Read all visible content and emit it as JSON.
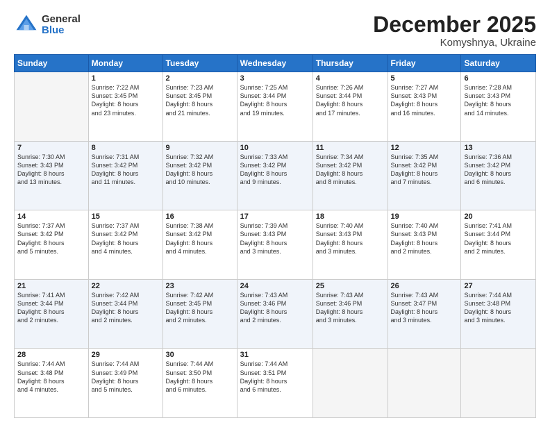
{
  "header": {
    "logo_general": "General",
    "logo_blue": "Blue",
    "month_title": "December 2025",
    "subtitle": "Komyshnya, Ukraine"
  },
  "days_of_week": [
    "Sunday",
    "Monday",
    "Tuesday",
    "Wednesday",
    "Thursday",
    "Friday",
    "Saturday"
  ],
  "weeks": [
    [
      {
        "day": "",
        "info": ""
      },
      {
        "day": "1",
        "info": "Sunrise: 7:22 AM\nSunset: 3:45 PM\nDaylight: 8 hours\nand 23 minutes."
      },
      {
        "day": "2",
        "info": "Sunrise: 7:23 AM\nSunset: 3:45 PM\nDaylight: 8 hours\nand 21 minutes."
      },
      {
        "day": "3",
        "info": "Sunrise: 7:25 AM\nSunset: 3:44 PM\nDaylight: 8 hours\nand 19 minutes."
      },
      {
        "day": "4",
        "info": "Sunrise: 7:26 AM\nSunset: 3:44 PM\nDaylight: 8 hours\nand 17 minutes."
      },
      {
        "day": "5",
        "info": "Sunrise: 7:27 AM\nSunset: 3:43 PM\nDaylight: 8 hours\nand 16 minutes."
      },
      {
        "day": "6",
        "info": "Sunrise: 7:28 AM\nSunset: 3:43 PM\nDaylight: 8 hours\nand 14 minutes."
      }
    ],
    [
      {
        "day": "7",
        "info": "Sunrise: 7:30 AM\nSunset: 3:43 PM\nDaylight: 8 hours\nand 13 minutes."
      },
      {
        "day": "8",
        "info": "Sunrise: 7:31 AM\nSunset: 3:42 PM\nDaylight: 8 hours\nand 11 minutes."
      },
      {
        "day": "9",
        "info": "Sunrise: 7:32 AM\nSunset: 3:42 PM\nDaylight: 8 hours\nand 10 minutes."
      },
      {
        "day": "10",
        "info": "Sunrise: 7:33 AM\nSunset: 3:42 PM\nDaylight: 8 hours\nand 9 minutes."
      },
      {
        "day": "11",
        "info": "Sunrise: 7:34 AM\nSunset: 3:42 PM\nDaylight: 8 hours\nand 8 minutes."
      },
      {
        "day": "12",
        "info": "Sunrise: 7:35 AM\nSunset: 3:42 PM\nDaylight: 8 hours\nand 7 minutes."
      },
      {
        "day": "13",
        "info": "Sunrise: 7:36 AM\nSunset: 3:42 PM\nDaylight: 8 hours\nand 6 minutes."
      }
    ],
    [
      {
        "day": "14",
        "info": "Sunrise: 7:37 AM\nSunset: 3:42 PM\nDaylight: 8 hours\nand 5 minutes."
      },
      {
        "day": "15",
        "info": "Sunrise: 7:37 AM\nSunset: 3:42 PM\nDaylight: 8 hours\nand 4 minutes."
      },
      {
        "day": "16",
        "info": "Sunrise: 7:38 AM\nSunset: 3:42 PM\nDaylight: 8 hours\nand 4 minutes."
      },
      {
        "day": "17",
        "info": "Sunrise: 7:39 AM\nSunset: 3:43 PM\nDaylight: 8 hours\nand 3 minutes."
      },
      {
        "day": "18",
        "info": "Sunrise: 7:40 AM\nSunset: 3:43 PM\nDaylight: 8 hours\nand 3 minutes."
      },
      {
        "day": "19",
        "info": "Sunrise: 7:40 AM\nSunset: 3:43 PM\nDaylight: 8 hours\nand 2 minutes."
      },
      {
        "day": "20",
        "info": "Sunrise: 7:41 AM\nSunset: 3:44 PM\nDaylight: 8 hours\nand 2 minutes."
      }
    ],
    [
      {
        "day": "21",
        "info": "Sunrise: 7:41 AM\nSunset: 3:44 PM\nDaylight: 8 hours\nand 2 minutes."
      },
      {
        "day": "22",
        "info": "Sunrise: 7:42 AM\nSunset: 3:44 PM\nDaylight: 8 hours\nand 2 minutes."
      },
      {
        "day": "23",
        "info": "Sunrise: 7:42 AM\nSunset: 3:45 PM\nDaylight: 8 hours\nand 2 minutes."
      },
      {
        "day": "24",
        "info": "Sunrise: 7:43 AM\nSunset: 3:46 PM\nDaylight: 8 hours\nand 2 minutes."
      },
      {
        "day": "25",
        "info": "Sunrise: 7:43 AM\nSunset: 3:46 PM\nDaylight: 8 hours\nand 3 minutes."
      },
      {
        "day": "26",
        "info": "Sunrise: 7:43 AM\nSunset: 3:47 PM\nDaylight: 8 hours\nand 3 minutes."
      },
      {
        "day": "27",
        "info": "Sunrise: 7:44 AM\nSunset: 3:48 PM\nDaylight: 8 hours\nand 3 minutes."
      }
    ],
    [
      {
        "day": "28",
        "info": "Sunrise: 7:44 AM\nSunset: 3:48 PM\nDaylight: 8 hours\nand 4 minutes."
      },
      {
        "day": "29",
        "info": "Sunrise: 7:44 AM\nSunset: 3:49 PM\nDaylight: 8 hours\nand 5 minutes."
      },
      {
        "day": "30",
        "info": "Sunrise: 7:44 AM\nSunset: 3:50 PM\nDaylight: 8 hours\nand 6 minutes."
      },
      {
        "day": "31",
        "info": "Sunrise: 7:44 AM\nSunset: 3:51 PM\nDaylight: 8 hours\nand 6 minutes."
      },
      {
        "day": "",
        "info": ""
      },
      {
        "day": "",
        "info": ""
      },
      {
        "day": "",
        "info": ""
      }
    ]
  ]
}
